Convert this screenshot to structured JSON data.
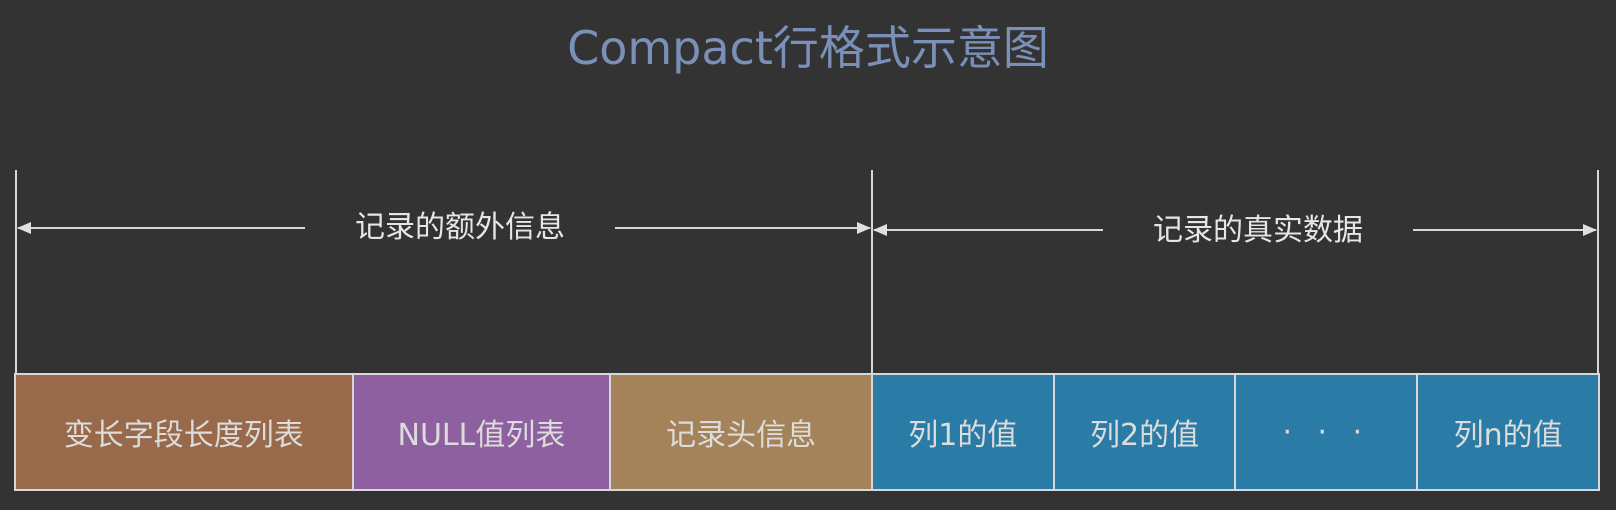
{
  "title": "Compact行格式示意图",
  "dimensions": {
    "extra_info_label": "记录的额外信息",
    "real_data_label": "记录的真实数据"
  },
  "segments": [
    {
      "label": "变长字段长度列表",
      "color": "#98694a"
    },
    {
      "label": "NULL值列表",
      "color": "#8e60a0"
    },
    {
      "label": "记录头信息",
      "color": "#a4835a"
    },
    {
      "label": "列1的值",
      "color": "#2a7ca6"
    },
    {
      "label": "列2的值",
      "color": "#2a7ca6"
    },
    {
      "label": "· · ·",
      "color": "#2a7ca6"
    },
    {
      "label": "列n的值",
      "color": "#2a7ca6"
    }
  ],
  "colors": {
    "background": "#333333",
    "title": "#7b90b8",
    "lines": "#d8d8d8"
  }
}
